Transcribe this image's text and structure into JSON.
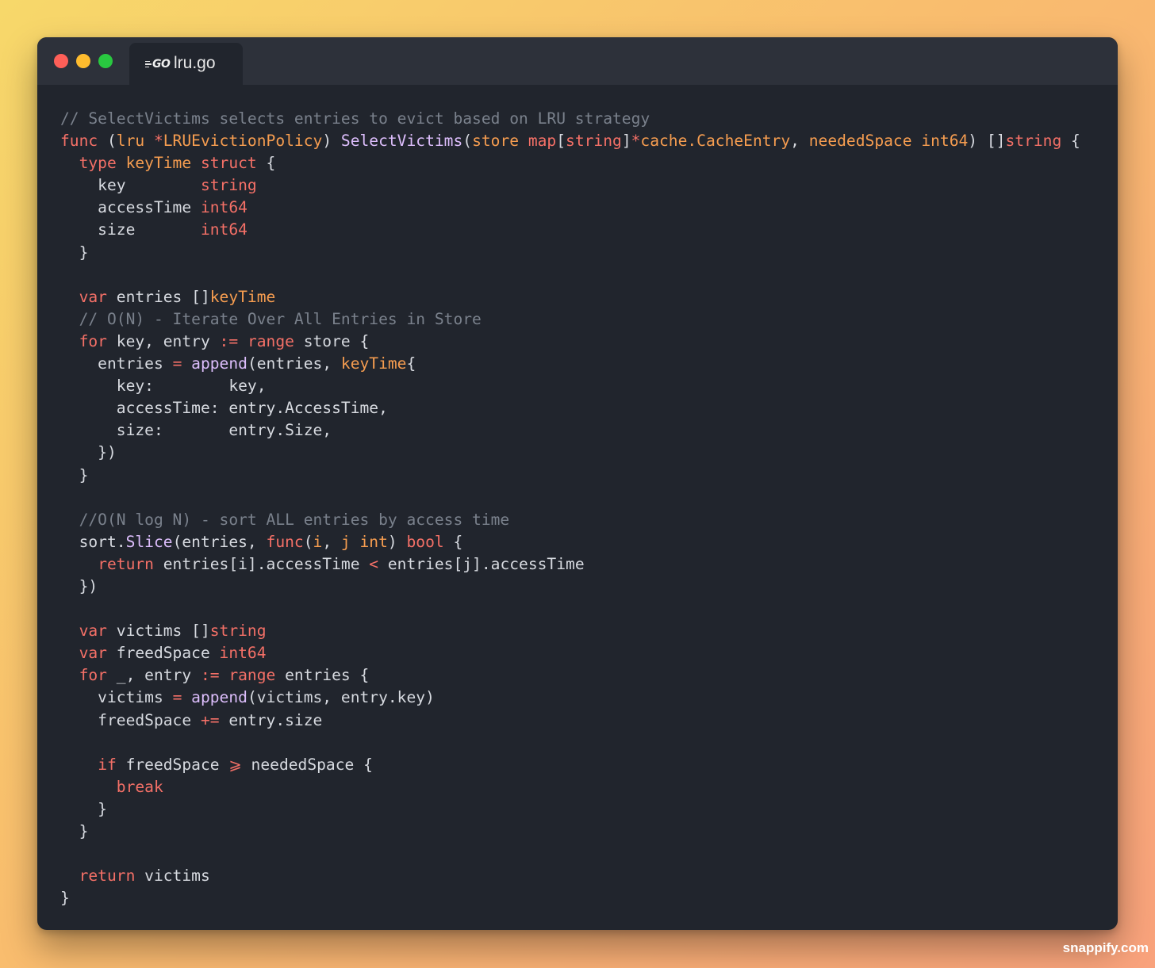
{
  "window": {
    "traffic_lights": [
      "close",
      "minimize",
      "maximize"
    ]
  },
  "tab": {
    "icon": "go-logo-icon",
    "icon_text": "GO",
    "title": "lru.go"
  },
  "code": {
    "language": "go",
    "lines": [
      [
        {
          "c": "c",
          "t": "// SelectVictims selects entries to evict based on LRU strategy"
        }
      ],
      [
        {
          "c": "k",
          "t": "func"
        },
        {
          "c": "p",
          "t": " ("
        },
        {
          "c": "t",
          "t": "lru"
        },
        {
          "c": "p",
          "t": " "
        },
        {
          "c": "k",
          "t": "*"
        },
        {
          "c": "t",
          "t": "LRUEvictionPolicy"
        },
        {
          "c": "p",
          "t": ") "
        },
        {
          "c": "f",
          "t": "SelectVictims"
        },
        {
          "c": "p",
          "t": "("
        },
        {
          "c": "t",
          "t": "store"
        },
        {
          "c": "p",
          "t": " "
        },
        {
          "c": "k",
          "t": "map"
        },
        {
          "c": "p",
          "t": "["
        },
        {
          "c": "k",
          "t": "string"
        },
        {
          "c": "p",
          "t": "]"
        },
        {
          "c": "k",
          "t": "*"
        },
        {
          "c": "t",
          "t": "cache.CacheEntry"
        },
        {
          "c": "p",
          "t": ", "
        },
        {
          "c": "t",
          "t": "neededSpace"
        },
        {
          "c": "p",
          "t": " "
        },
        {
          "c": "t",
          "t": "int64"
        },
        {
          "c": "p",
          "t": ") []"
        },
        {
          "c": "k",
          "t": "string"
        },
        {
          "c": "p",
          "t": " {"
        }
      ],
      [
        {
          "c": "p",
          "t": "  "
        },
        {
          "c": "k",
          "t": "type"
        },
        {
          "c": "p",
          "t": " "
        },
        {
          "c": "t",
          "t": "keyTime"
        },
        {
          "c": "p",
          "t": " "
        },
        {
          "c": "k",
          "t": "struct"
        },
        {
          "c": "p",
          "t": " {"
        }
      ],
      [
        {
          "c": "p",
          "t": "    key        "
        },
        {
          "c": "k",
          "t": "string"
        }
      ],
      [
        {
          "c": "p",
          "t": "    accessTime "
        },
        {
          "c": "k",
          "t": "int64"
        }
      ],
      [
        {
          "c": "p",
          "t": "    size       "
        },
        {
          "c": "k",
          "t": "int64"
        }
      ],
      [
        {
          "c": "p",
          "t": "  }"
        }
      ],
      [
        {
          "c": "p",
          "t": ""
        }
      ],
      [
        {
          "c": "p",
          "t": "  "
        },
        {
          "c": "k",
          "t": "var"
        },
        {
          "c": "p",
          "t": " entries []"
        },
        {
          "c": "t",
          "t": "keyTime"
        }
      ],
      [
        {
          "c": "c",
          "t": "  // O(N) - Iterate Over All Entries in Store"
        }
      ],
      [
        {
          "c": "p",
          "t": "  "
        },
        {
          "c": "k",
          "t": "for"
        },
        {
          "c": "p",
          "t": " key, entry "
        },
        {
          "c": "k",
          "t": ":="
        },
        {
          "c": "p",
          "t": " "
        },
        {
          "c": "k",
          "t": "range"
        },
        {
          "c": "p",
          "t": " store {"
        }
      ],
      [
        {
          "c": "p",
          "t": "    entries "
        },
        {
          "c": "k",
          "t": "="
        },
        {
          "c": "p",
          "t": " "
        },
        {
          "c": "f",
          "t": "append"
        },
        {
          "c": "p",
          "t": "(entries, "
        },
        {
          "c": "t",
          "t": "keyTime"
        },
        {
          "c": "p",
          "t": "{"
        }
      ],
      [
        {
          "c": "p",
          "t": "      key:        key,"
        }
      ],
      [
        {
          "c": "p",
          "t": "      accessTime: entry.AccessTime,"
        }
      ],
      [
        {
          "c": "p",
          "t": "      size:       entry.Size,"
        }
      ],
      [
        {
          "c": "p",
          "t": "    })"
        }
      ],
      [
        {
          "c": "p",
          "t": "  }"
        }
      ],
      [
        {
          "c": "p",
          "t": ""
        }
      ],
      [
        {
          "c": "c",
          "t": "  //O(N log N) - sort ALL entries by access time"
        }
      ],
      [
        {
          "c": "p",
          "t": "  sort."
        },
        {
          "c": "f",
          "t": "Slice"
        },
        {
          "c": "p",
          "t": "(entries, "
        },
        {
          "c": "k",
          "t": "func"
        },
        {
          "c": "p",
          "t": "("
        },
        {
          "c": "t",
          "t": "i"
        },
        {
          "c": "p",
          "t": ", "
        },
        {
          "c": "t",
          "t": "j"
        },
        {
          "c": "p",
          "t": " "
        },
        {
          "c": "t",
          "t": "int"
        },
        {
          "c": "p",
          "t": ") "
        },
        {
          "c": "k",
          "t": "bool"
        },
        {
          "c": "p",
          "t": " {"
        }
      ],
      [
        {
          "c": "p",
          "t": "    "
        },
        {
          "c": "k",
          "t": "return"
        },
        {
          "c": "p",
          "t": " entries[i].accessTime "
        },
        {
          "c": "k",
          "t": "<"
        },
        {
          "c": "p",
          "t": " entries[j].accessTime"
        }
      ],
      [
        {
          "c": "p",
          "t": "  })"
        }
      ],
      [
        {
          "c": "p",
          "t": ""
        }
      ],
      [
        {
          "c": "p",
          "t": "  "
        },
        {
          "c": "k",
          "t": "var"
        },
        {
          "c": "p",
          "t": " victims []"
        },
        {
          "c": "k",
          "t": "string"
        }
      ],
      [
        {
          "c": "p",
          "t": "  "
        },
        {
          "c": "k",
          "t": "var"
        },
        {
          "c": "p",
          "t": " freedSpace "
        },
        {
          "c": "k",
          "t": "int64"
        }
      ],
      [
        {
          "c": "p",
          "t": "  "
        },
        {
          "c": "k",
          "t": "for"
        },
        {
          "c": "p",
          "t": " _, entry "
        },
        {
          "c": "k",
          "t": ":="
        },
        {
          "c": "p",
          "t": " "
        },
        {
          "c": "k",
          "t": "range"
        },
        {
          "c": "p",
          "t": " entries {"
        }
      ],
      [
        {
          "c": "p",
          "t": "    victims "
        },
        {
          "c": "k",
          "t": "="
        },
        {
          "c": "p",
          "t": " "
        },
        {
          "c": "f",
          "t": "append"
        },
        {
          "c": "p",
          "t": "(victims, entry.key)"
        }
      ],
      [
        {
          "c": "p",
          "t": "    freedSpace "
        },
        {
          "c": "k",
          "t": "+="
        },
        {
          "c": "p",
          "t": " entry.size"
        }
      ],
      [
        {
          "c": "p",
          "t": ""
        }
      ],
      [
        {
          "c": "p",
          "t": "    "
        },
        {
          "c": "k",
          "t": "if"
        },
        {
          "c": "p",
          "t": " freedSpace "
        },
        {
          "c": "k",
          "t": "⩾"
        },
        {
          "c": "p",
          "t": " neededSpace {"
        }
      ],
      [
        {
          "c": "p",
          "t": "      "
        },
        {
          "c": "k",
          "t": "break"
        }
      ],
      [
        {
          "c": "p",
          "t": "    }"
        }
      ],
      [
        {
          "c": "p",
          "t": "  }"
        }
      ],
      [
        {
          "c": "p",
          "t": ""
        }
      ],
      [
        {
          "c": "p",
          "t": "  "
        },
        {
          "c": "k",
          "t": "return"
        },
        {
          "c": "p",
          "t": " victims"
        }
      ],
      [
        {
          "c": "p",
          "t": "}"
        }
      ]
    ]
  },
  "watermark": "snappify.com",
  "colors": {
    "background_gradient": [
      "#f7d86a",
      "#f9bd6e",
      "#f9a27c"
    ],
    "editor_bg": "#21252d",
    "titlebar_bg": "#2d313a",
    "comment": "#7a818c",
    "keyword": "#f47067",
    "type": "#f69d50",
    "function": "#dcbdfb",
    "plain": "#d7dae0"
  }
}
